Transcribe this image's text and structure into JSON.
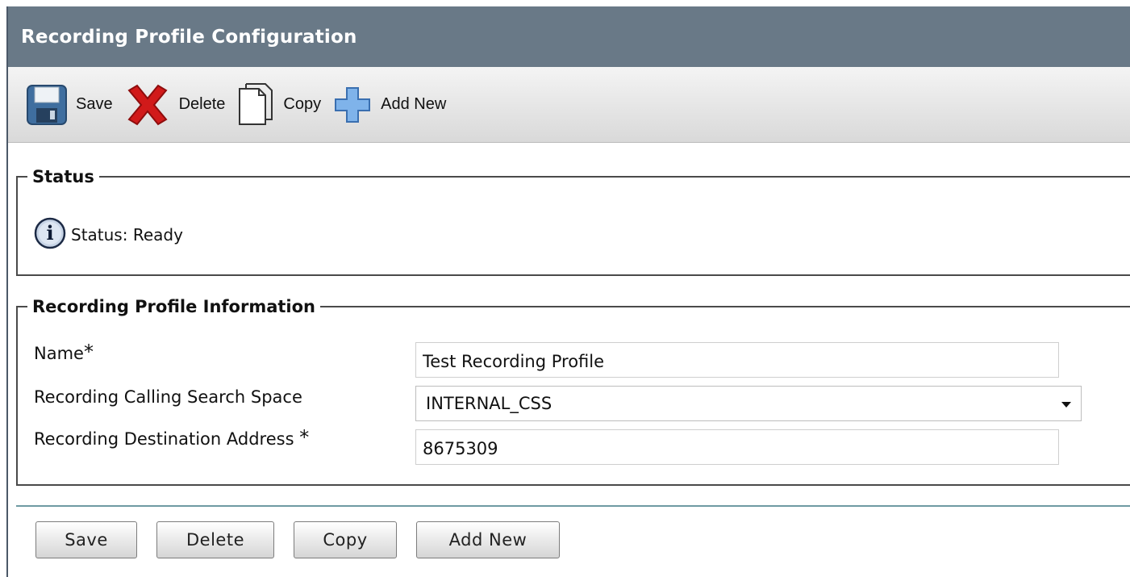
{
  "top_strip_text": "",
  "header": {
    "title": "Recording Profile Configuration"
  },
  "toolbar": {
    "save_label": "Save",
    "delete_label": "Delete",
    "copy_label": "Copy",
    "add_new_label": "Add New",
    "icons": {
      "save": "save-icon",
      "delete": "delete-icon",
      "copy": "copy-icon",
      "add_new": "add-new-icon"
    }
  },
  "status": {
    "legend": "Status",
    "icon": "info-icon",
    "text": "Status: Ready"
  },
  "recording_profile": {
    "legend": "Recording Profile Information",
    "name_label": "Name",
    "name_value": "Test Recording Profile",
    "css_label": "Recording Calling Search Space",
    "css_value": "INTERNAL_CSS",
    "destination_label": "Recording Destination Address ",
    "destination_value": "8675309",
    "required_marker": "*"
  },
  "buttons": {
    "save": "Save",
    "delete": "Delete",
    "copy": "Copy",
    "add_new": "Add New"
  },
  "colors": {
    "header_bg": "#697987",
    "divider": "#6f9aa3",
    "delete_red": "#d11a1a",
    "add_blue": "#6fa8e6",
    "save_blue": "#3f6e9f"
  }
}
